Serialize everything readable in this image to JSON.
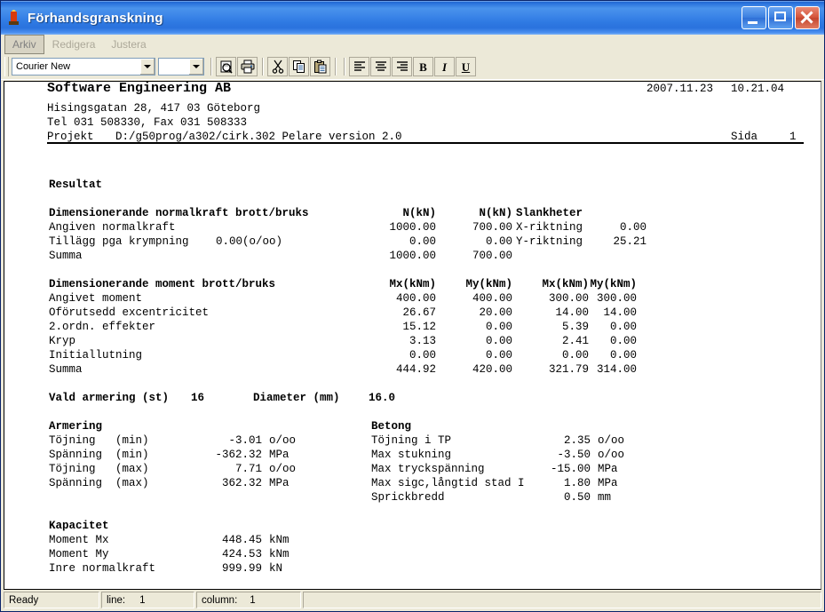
{
  "window": {
    "title": "Förhandsgranskning",
    "icon": "app-icon",
    "minimize_label": "",
    "maximize_label": "",
    "close_label": ""
  },
  "menu": {
    "items": [
      {
        "label": "Arkiv",
        "selected": true
      },
      {
        "label": "Redigera",
        "selected": false
      },
      {
        "label": "Justera",
        "selected": false
      }
    ]
  },
  "toolbar": {
    "font_name": "Courier New",
    "font_size": "",
    "buttons": [
      {
        "name": "print-preview-icon",
        "label": ""
      },
      {
        "name": "print-icon",
        "label": ""
      },
      {
        "name": "cut-icon",
        "label": ""
      },
      {
        "name": "copy-icon",
        "label": ""
      },
      {
        "name": "paste-icon",
        "label": ""
      },
      {
        "name": "align-left-icon",
        "label": ""
      },
      {
        "name": "align-center-icon",
        "label": ""
      },
      {
        "name": "align-right-icon",
        "label": ""
      },
      {
        "name": "bold-button",
        "label": "B"
      },
      {
        "name": "italic-button",
        "label": "I"
      },
      {
        "name": "underline-button",
        "label": "U"
      }
    ]
  },
  "document": {
    "header": {
      "company": "Software Engineering AB",
      "address": "Hisingsgatan 28, 417 03 Göteborg",
      "phone": "Tel 031 508330, Fax 031 508333",
      "project_label": "Projekt",
      "project_path": "D:/g50prog/a302/cirk.302 Pelare version 2.0",
      "date": "2007.11.23",
      "time": "10.21.04",
      "page_label": "Sida",
      "page_number": "1"
    },
    "result_title": "Resultat",
    "normalkraft": {
      "title": "Dimensionerande normalkraft brott/bruks",
      "col1_header": "N(kN)",
      "col2_header": "N(kN)",
      "rows": [
        {
          "label": "Angiven normalkraft",
          "extra": "",
          "brott": "1000.00",
          "bruks": "700.00"
        },
        {
          "label": "Tillägg pga krympning",
          "extra": "0.00(o/oo)",
          "brott": "0.00",
          "bruks": "0.00"
        },
        {
          "label": "Summa",
          "extra": "",
          "brott": "1000.00",
          "bruks": "700.00"
        }
      ]
    },
    "slankheter": {
      "title": "Slankheter",
      "rows": [
        {
          "label": "X-riktning",
          "value": "0.00"
        },
        {
          "label": "Y-riktning",
          "value": "25.21"
        }
      ]
    },
    "moment": {
      "title": "Dimensionerande moment brott/bruks",
      "headers": [
        "Mx(kNm)",
        "My(kNm)",
        "Mx(kNm)",
        "My(kNm)"
      ],
      "rows": [
        {
          "label": "Angivet moment",
          "values": [
            "400.00",
            "400.00",
            "300.00",
            "300.00"
          ]
        },
        {
          "label": "Oförutsedd excentricitet",
          "values": [
            "26.67",
            "20.00",
            "14.00",
            "14.00"
          ]
        },
        {
          "label": "2.ordn. effekter",
          "values": [
            "15.12",
            "0.00",
            "5.39",
            "0.00"
          ]
        },
        {
          "label": "Kryp",
          "values": [
            "3.13",
            "0.00",
            "2.41",
            "0.00"
          ]
        },
        {
          "label": "Initiallutning",
          "values": [
            "0.00",
            "0.00",
            "0.00",
            "0.00"
          ]
        },
        {
          "label": "Summa",
          "values": [
            "444.92",
            "420.00",
            "321.79",
            "314.00"
          ]
        }
      ]
    },
    "vald_armering": {
      "label": "Vald armering (st)",
      "count": "16",
      "diameter_label": "Diameter (mm)",
      "diameter": "16.0"
    },
    "armering": {
      "title": "Armering",
      "rows": [
        {
          "label": "Töjning   (min)",
          "value": "-3.01",
          "unit": "o/oo"
        },
        {
          "label": "Spänning  (min)",
          "value": "-362.32",
          "unit": "MPa"
        },
        {
          "label": "Töjning   (max)",
          "value": "7.71",
          "unit": "o/oo"
        },
        {
          "label": "Spänning  (max)",
          "value": "362.32",
          "unit": "MPa"
        }
      ]
    },
    "betong": {
      "title": "Betong",
      "rows": [
        {
          "label": "Töjning i TP",
          "value": "2.35",
          "unit": "o/oo"
        },
        {
          "label": "Max stukning",
          "value": "-3.50",
          "unit": "o/oo"
        },
        {
          "label": "Max tryckspänning",
          "value": "-15.00",
          "unit": "MPa"
        },
        {
          "label": "Max sigc,långtid stad I",
          "value": "1.80",
          "unit": "MPa"
        },
        {
          "label": "Sprickbredd",
          "value": "0.50",
          "unit": "mm"
        }
      ]
    },
    "kapacitet": {
      "title": "Kapacitet",
      "rows": [
        {
          "label": "Moment Mx",
          "value": "448.45",
          "unit": "kNm"
        },
        {
          "label": "Moment My",
          "value": "424.53",
          "unit": "kNm"
        },
        {
          "label": "Inre normalkraft",
          "value": "999.99",
          "unit": "kN"
        }
      ]
    }
  },
  "status_bar": {
    "ready": "Ready",
    "line_label": "line:",
    "line_value": "1",
    "column_label": "column:",
    "column_value": "1"
  },
  "colors": {
    "title_bar_blue": "#2f7ae3",
    "face": "#ece9d8",
    "close_red": "#c4452e",
    "text": "#000000"
  }
}
